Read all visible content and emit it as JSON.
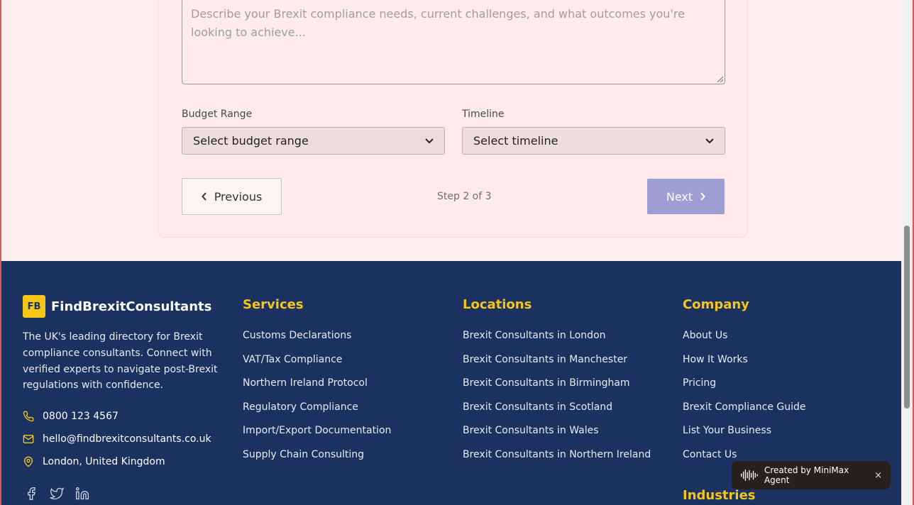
{
  "form": {
    "textarea_placeholder": "Describe your Brexit compliance needs, current challenges, and what outcomes you're looking to achieve...",
    "budget_label": "Budget Range",
    "budget_value": "Select budget range",
    "timeline_label": "Timeline",
    "timeline_value": "Select timeline",
    "prev_label": "Previous",
    "step_text": "Step 2 of 3",
    "next_label": "Next"
  },
  "footer": {
    "logo_badge": "FB",
    "brand": "FindBrexitConsultants",
    "about": "The UK's leading directory for Brexit compliance consultants. Connect with verified experts to navigate post-Brexit regulations with confidence.",
    "phone": "0800 123 4567",
    "email": "hello@findbrexitconsultants.co.uk",
    "address": "London, United Kingdom",
    "services": {
      "title": "Services",
      "items": [
        "Customs Declarations",
        "VAT/Tax Compliance",
        "Northern Ireland Protocol",
        "Regulatory Compliance",
        "Import/Export Documentation",
        "Supply Chain Consulting"
      ]
    },
    "locations": {
      "title": "Locations",
      "items": [
        "Brexit Consultants in London",
        "Brexit Consultants in Manchester",
        "Brexit Consultants in Birmingham",
        "Brexit Consultants in Scotland",
        "Brexit Consultants in Wales",
        "Brexit Consultants in Northern Ireland"
      ]
    },
    "company": {
      "title": "Company",
      "items": [
        "About Us",
        "How It Works",
        "Pricing",
        "Brexit Compliance Guide",
        "List Your Business",
        "Contact Us"
      ]
    },
    "industries_title": "Industries"
  },
  "toast": {
    "text": "Created by MiniMax Agent",
    "close": "×"
  },
  "colors": {
    "footer_bg": "#1b3260",
    "accent": "#f5c518",
    "next_button": "#9e9ed4",
    "page_bg": "#fdeeee"
  },
  "icons": [
    "chevron-left-icon",
    "chevron-right-icon",
    "phone-icon",
    "mail-icon",
    "map-pin-icon",
    "facebook-icon",
    "twitter-icon",
    "linkedin-icon",
    "waveform-icon",
    "close-icon"
  ]
}
